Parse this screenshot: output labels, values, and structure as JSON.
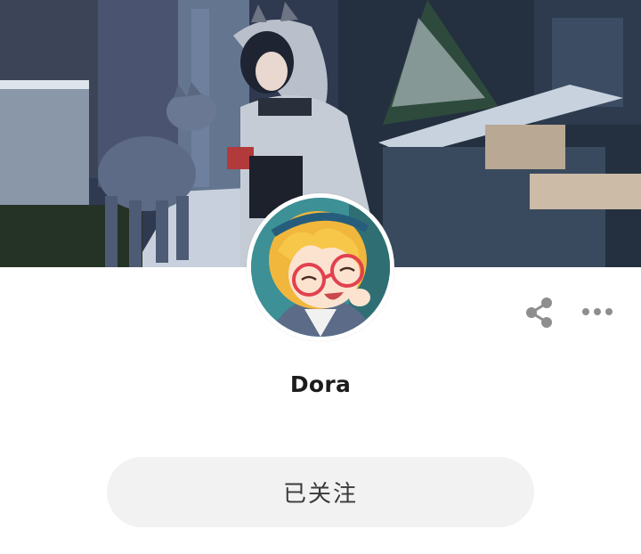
{
  "profile": {
    "username": "Dora",
    "banner_image": "anime-girl-with-wolf-winter-city",
    "avatar_image": "anime-blonde-girl-glasses"
  },
  "header": {
    "share_icon": "share-icon",
    "more_icon": "more-icon"
  },
  "actions": {
    "follow_label": "已关注"
  },
  "colors": {
    "follow_button_bg": "#f2f2f2",
    "username_text": "#1c1c1c",
    "icon_gray": "#8e8e8e"
  }
}
